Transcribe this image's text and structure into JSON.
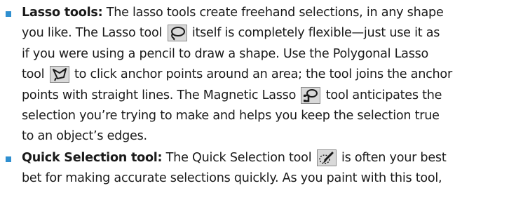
{
  "items": [
    {
      "term": "Lasso tools:",
      "lines": [
        " The lasso tools create freehand selections, in any shape",
        "you like. The Lasso tool ",
        " itself is completely flexible—just use it as",
        "if you were using a pencil to draw a shape. Use the Polygonal Lasso",
        "tool ",
        " to click anchor points around an area; the tool joins the anchor",
        "points with straight lines. The Magnetic Lasso ",
        " tool anticipates the",
        "selection you’re trying to make and helps you keep the selection true",
        "to an object’s edges."
      ],
      "icons": [
        "lasso-icon",
        "polygonal-lasso-icon",
        "magnetic-lasso-icon"
      ]
    },
    {
      "term": "Quick Selection tool:",
      "lines": [
        " The Quick Selection tool ",
        " is often your best",
        "bet for making accurate selections quickly. As you paint with this tool,"
      ],
      "icons": [
        "quick-selection-icon"
      ]
    }
  ],
  "colors": {
    "bullet": "#2f8fd0",
    "text": "#1a1a1a",
    "icon_bg": "#d9d9d9",
    "icon_border": "#8a8a8a"
  }
}
